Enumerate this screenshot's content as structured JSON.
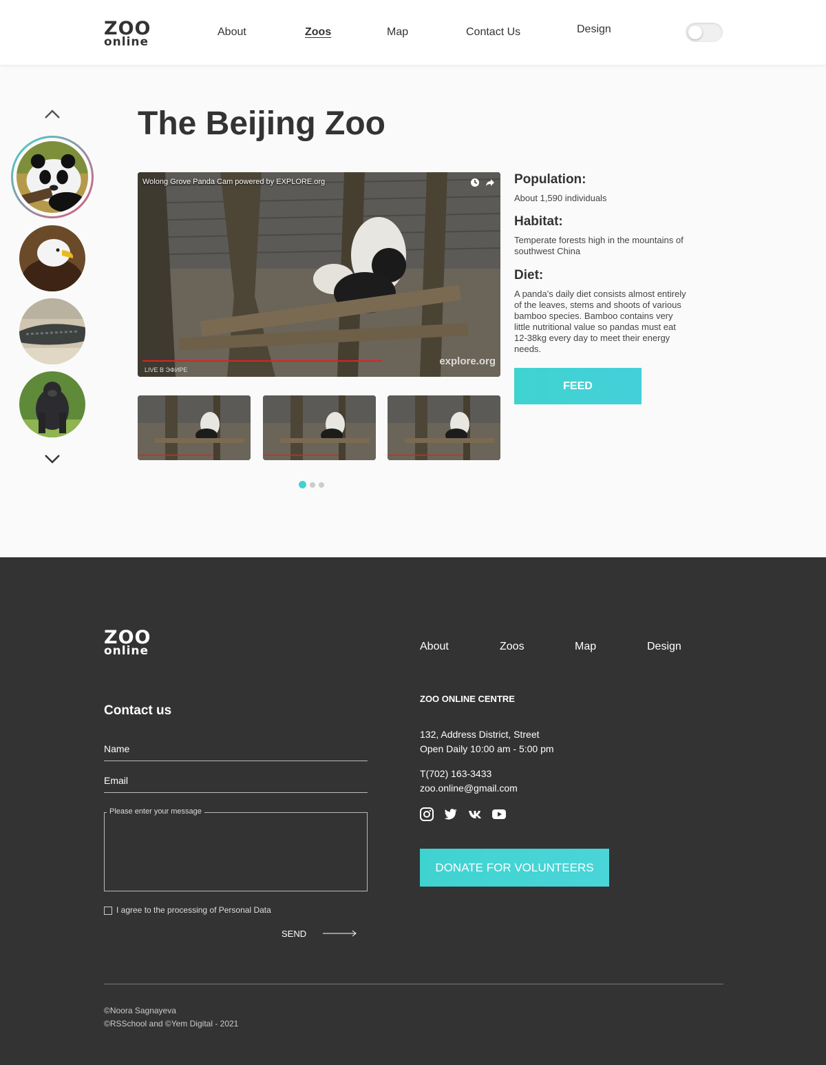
{
  "header": {
    "logo_top": "ZOO",
    "logo_bottom": "online",
    "nav": [
      "About",
      "Zoos",
      "Map",
      "Contact Us",
      "Design"
    ],
    "active_nav": "Zoos",
    "theme_toggle": "off"
  },
  "sidebar": {
    "animals": [
      "panda",
      "eagle",
      "alligator",
      "gorilla"
    ],
    "selected": "panda"
  },
  "main": {
    "title": "The Beijing Zoo",
    "video": {
      "title": "Wolong Grove Panda Cam powered by EXPLORE.org",
      "brand": "explore.org",
      "live": "LIVE В ЭФИРЕ",
      "progress": 0.67
    },
    "thumbnails_count": 3,
    "dots": {
      "count": 3,
      "active": 0
    },
    "info": {
      "population_label": "Population:",
      "population_value": "About 1,590 individuals",
      "habitat_label": "Habitat:",
      "habitat_value": "Temperate forests high in the mountains of southwest China",
      "diet_label": "Diet:",
      "diet_value": "A panda's daily diet consists almost entirely of the leaves, stems and shoots of various bamboo species. Bamboo contains very little nutritional value so pandas must eat 12-38kg every day to meet their energy needs."
    },
    "feed_label": "FEED"
  },
  "footer": {
    "logo_top": "ZOO",
    "logo_bottom": "online",
    "nav": [
      "About",
      "Zoos",
      "Map",
      "Design"
    ],
    "contact_title": "Contact us",
    "name_placeholder": "Name",
    "email_placeholder": "Email",
    "message_placeholder": "Please enter your message",
    "agree_text": "I agree to the processing of Personal Data",
    "send_label": "SEND",
    "centre_title": "ZOO ONLINE CENTRE",
    "address_line1": "132, Address District, Street",
    "address_line2": "Open Daily 10:00 am - 5:00 pm",
    "phone": "T(702) 163-3433",
    "email": "zoo.online@gmail.com",
    "socials": [
      "instagram-icon",
      "twitter-icon",
      "vk-icon",
      "youtube-icon"
    ],
    "donate_label": "DONATE FOR VOLUNTEERS",
    "copyright1": "©Noora Sagnayeva",
    "copyright2": "©RSSchool and ©Yem Digital - 2021"
  },
  "colors": {
    "accent": "#41d2cf",
    "footer_bg": "#333333",
    "ring_start": "#3fd3d0",
    "ring_end": "#e0567a"
  }
}
